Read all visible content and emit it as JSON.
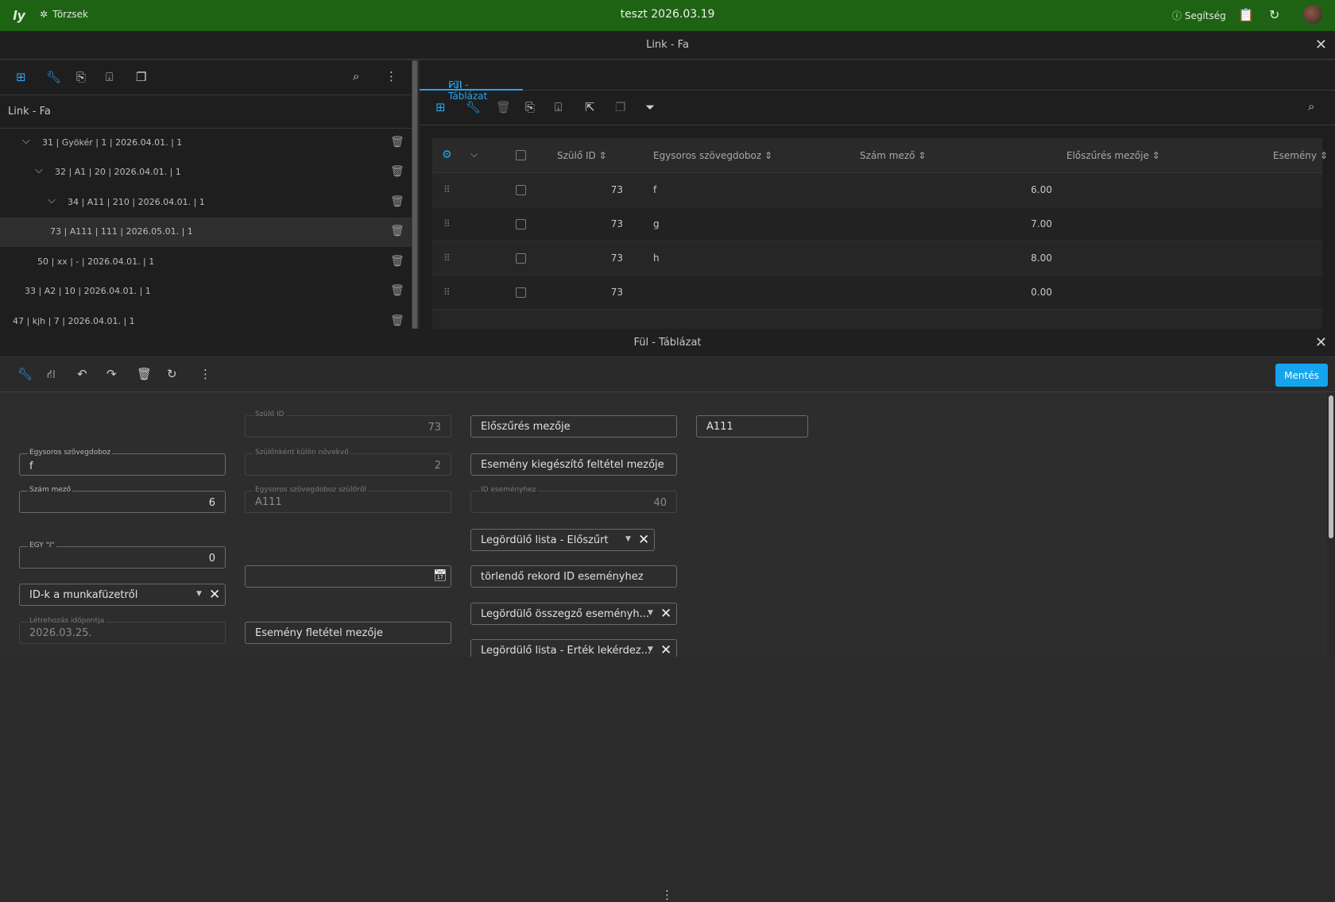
{
  "topbar": {
    "brand": "ly",
    "menu_label": "Törzsek",
    "title": "teszt 2026.03.19",
    "help_label": "Segítség"
  },
  "window1": {
    "title": "Link - Fa"
  },
  "left": {
    "header": "Link - Fa",
    "rows": [
      "31 | Gyökér | 1 | 2026.04.01. | 1",
      "32 | A1 | 20 | 2026.04.01. | 1",
      "34 | A11 | 210 | 2026.04.01. | 1",
      "73 | A111 | 111 | 2026.05.01. | 1",
      "50 | xx | - | 2026.04.01. | 1",
      "33 | A2 | 10 | 2026.04.01. | 1",
      "47 | kjh | 7 | 2026.04.01. | 1"
    ]
  },
  "right": {
    "tab_label": "Fül - Táblázat",
    "columns": [
      "Szülő ID",
      "Egysoros szövegdoboz",
      "Szám mező",
      "Előszűrés mezője",
      "Esemény"
    ],
    "rows": [
      {
        "id": "73",
        "text": "f",
        "num": "6.00"
      },
      {
        "id": "73",
        "text": "g",
        "num": "7.00"
      },
      {
        "id": "73",
        "text": "h",
        "num": "8.00"
      },
      {
        "id": "73",
        "text": "",
        "num": "0.00"
      }
    ]
  },
  "window2": {
    "title": "Fül - Táblázat"
  },
  "form": {
    "save_label": "Mentés",
    "egysoros": {
      "label": "Egysoros szövegdoboz",
      "value": "f"
    },
    "szam": {
      "label": "Szám mező",
      "value": "6"
    },
    "egy": {
      "label": "EGY \"I\"",
      "value": "0"
    },
    "idk": {
      "value": "ID-k a munkafüzetről"
    },
    "letrehozas": {
      "label": "Létrehozás időpontja",
      "value": "2026.03.25."
    },
    "szulo_id": {
      "label": "Szülő ID",
      "value": "73"
    },
    "szulonkent": {
      "label": "Szülőnként külön növekvő",
      "value": "2"
    },
    "egysoros_szulo": {
      "label": "Egysoros szövegdoboz szülőről",
      "value": "A111"
    },
    "esemeny_feltetel": {
      "value": "Esemény fletétel mezője"
    },
    "eloszures": {
      "value": "Előszűrés mezője"
    },
    "esemeny_kieg": {
      "value": "Esemény kiegészítő feltétel mezője"
    },
    "id_esemenyhez": {
      "label": "ID eseményhez",
      "value": "40"
    },
    "legordulo_eloszurt": {
      "value": "Legördülő lista - Előszűrt"
    },
    "torlendo": {
      "value": "törlendő rekord ID eseményhez"
    },
    "legordulo_osszegzo": {
      "value": "Legördülő összegző eseményh..."
    },
    "legordulo_ertek": {
      "value": "Legördülő lista - Érték lekérdez..."
    },
    "a111": {
      "value": "A111"
    }
  }
}
